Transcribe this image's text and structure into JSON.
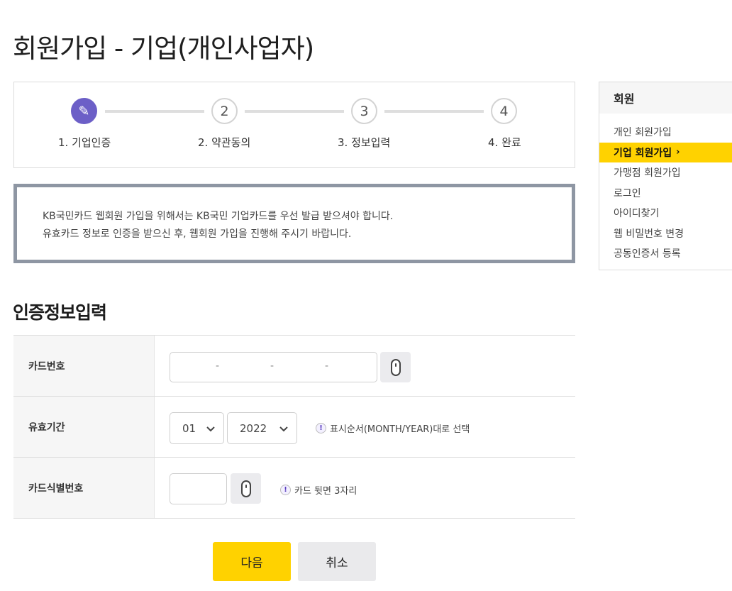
{
  "page": {
    "title": "회원가입 - 기업(개인사업자)"
  },
  "steps": [
    {
      "number": "✎",
      "label": "1. 기업인증",
      "active": true
    },
    {
      "number": "2",
      "label": "2. 약관동의",
      "active": false
    },
    {
      "number": "3",
      "label": "3. 정보입력",
      "active": false
    },
    {
      "number": "4",
      "label": "4. 완료",
      "active": false
    }
  ],
  "notice": {
    "line1": "KB국민카드 웹회원 가입을 위해서는 KB국민 기업카드를 우선 발급 받으셔야 합니다.",
    "line2": "유효카드 정보로 인증을 받으신 후, 웹회원 가입을 진행해 주시기 바랍니다."
  },
  "section": {
    "title": "인증정보입력"
  },
  "form": {
    "card_number": {
      "label": "카드번호",
      "separator": "-"
    },
    "expiry": {
      "label": "유효기간",
      "month": "01",
      "year": "2022",
      "hint": "표시순서(MONTH/YEAR)대로 선택"
    },
    "cvc": {
      "label": "카드식별번호",
      "hint": "카드 뒷면 3자리"
    }
  },
  "buttons": {
    "next": "다음",
    "cancel": "취소"
  },
  "sidenav": {
    "title": "회원",
    "items": [
      {
        "label": "개인 회원가입",
        "active": false
      },
      {
        "label": "기업 회원가입",
        "active": true,
        "arrow": "›"
      },
      {
        "label": "가맹점 회원가입",
        "active": false
      },
      {
        "label": "로그인",
        "active": false
      },
      {
        "label": "아이디찾기",
        "active": false
      },
      {
        "label": "웹 비밀번호 변경",
        "active": false
      },
      {
        "label": "공동인증서 등록",
        "active": false
      }
    ]
  },
  "colors": {
    "accent": "#ffd200",
    "step_active": "#6c5fc7",
    "notice_border": "#8e96a3"
  }
}
